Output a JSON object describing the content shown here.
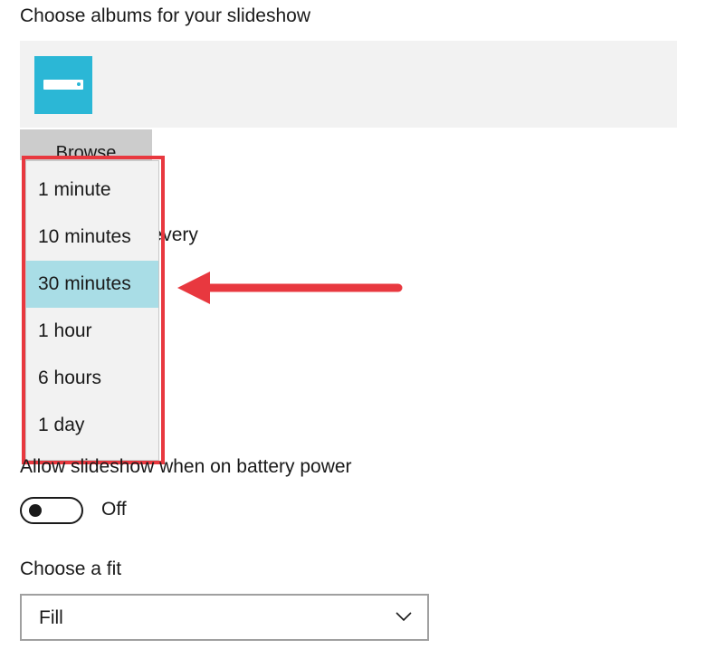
{
  "albums_section": {
    "title": "Choose albums for your slideshow",
    "album_icon": "drive-icon",
    "browse_label": "Browse"
  },
  "change_picture": {
    "label_visible_fragment": "e every"
  },
  "interval_dropdown": {
    "options": [
      "1 minute",
      "10 minutes",
      "30 minutes",
      "1 hour",
      "6 hours",
      "1 day"
    ],
    "selected": "30 minutes"
  },
  "battery": {
    "label": "Allow slideshow when on battery power",
    "toggle_state": "Off"
  },
  "fit": {
    "label": "Choose a fit",
    "value": "Fill"
  },
  "colors": {
    "accent": "#2bb7d6",
    "selection": "#a9dde6",
    "annotation_red": "#e8383f"
  }
}
